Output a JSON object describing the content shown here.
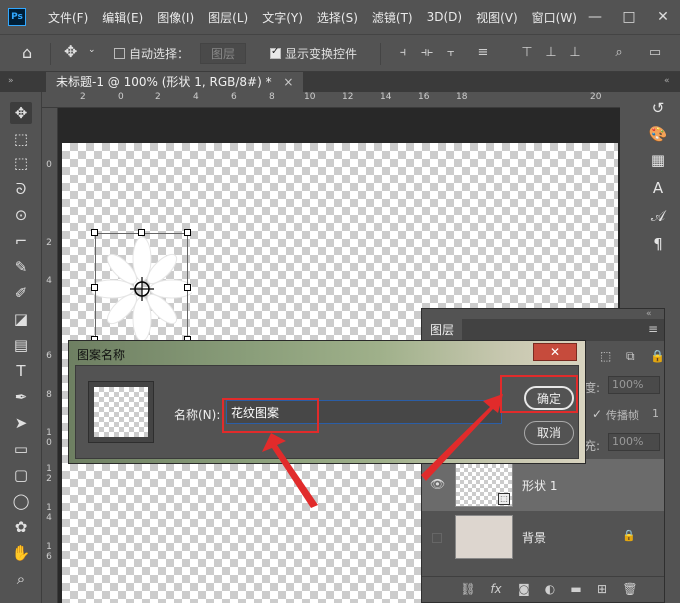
{
  "app": {
    "logo": "Ps",
    "menu": [
      "文件(F)",
      "编辑(E)",
      "图像(I)",
      "图层(L)",
      "文字(Y)",
      "选择(S)",
      "滤镜(T)",
      "3D(D)",
      "视图(V)",
      "窗口(W)"
    ],
    "window_controls": {
      "minimize": "—",
      "maximize": "□",
      "close": "✕"
    }
  },
  "options_bar": {
    "auto_select_label": "自动选择：",
    "auto_select_target": "图层",
    "show_transform_label": "显示变换控件"
  },
  "document_tab": {
    "title": "未标题-1 @ 100% (形状 1, RGB/8#) *",
    "close": "×"
  },
  "ruler": {
    "top": [
      "2",
      "0",
      "2",
      "4",
      "6",
      "8",
      "10",
      "12",
      "14",
      "16",
      "18",
      "20"
    ],
    "left": [
      "0",
      "2",
      "4",
      "6",
      "8",
      "1\n0",
      "1\n2",
      "1\n4",
      "1\n6"
    ]
  },
  "tools": [
    "move-tool",
    "artboard-tool",
    "marquee-tool",
    "lasso-tool",
    "quick-select-tool",
    "crop-tool",
    "eyedropper-tool",
    "brush-tool",
    "eraser-tool",
    "gradient-tool",
    "type-tool",
    "pen-tool",
    "path-select-tool",
    "rectangle-tool",
    "rounded-rect-tool",
    "ellipse-tool",
    "custom-shape-tool",
    "hand-tool",
    "zoom-tool"
  ],
  "layers_panel": {
    "title": "图层",
    "opacity_label": "度:",
    "opacity_value": "100%",
    "propagate_label": "传播帧",
    "propagate_value": "1",
    "fill_label": "充:",
    "fill_value": "100%",
    "layers": [
      {
        "name": "形状 1",
        "visible": true,
        "selected": true
      },
      {
        "name": "背景",
        "visible": false,
        "locked": true
      }
    ]
  },
  "dialog": {
    "title": "图案名称",
    "close_icon": "✕",
    "name_label": "名称(N):",
    "name_value": "花纹图案",
    "ok_label": "确定",
    "cancel_label": "取消"
  },
  "colors": {
    "accent_blue": "#2b5ea6",
    "highlight_red": "#e12b2b",
    "close_red": "#c64b3c"
  }
}
